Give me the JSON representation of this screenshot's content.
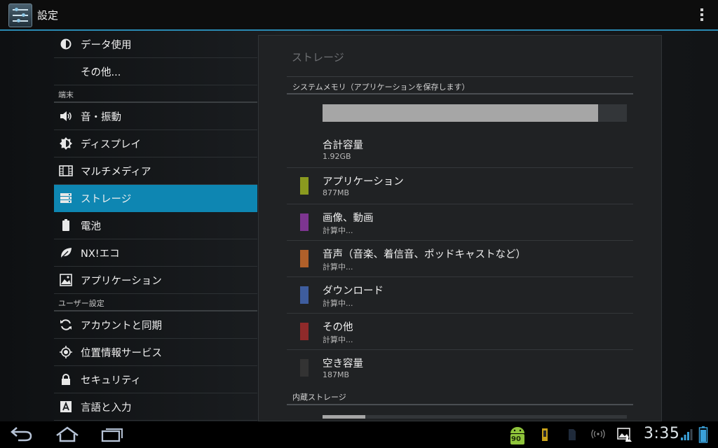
{
  "app": {
    "title": "設定",
    "icon": "settings-sliders-icon"
  },
  "sidebar": {
    "items": [
      {
        "label": "データ使用",
        "icon": "data-usage-icon"
      },
      {
        "label": "その他...",
        "icon": ""
      },
      {
        "section": "端末"
      },
      {
        "label": "音・振動",
        "icon": "volume-icon"
      },
      {
        "label": "ディスプレイ",
        "icon": "brightness-icon"
      },
      {
        "label": "マルチメディア",
        "icon": "film-icon"
      },
      {
        "label": "ストレージ",
        "icon": "storage-icon",
        "selected": true
      },
      {
        "label": "電池",
        "icon": "battery-icon"
      },
      {
        "label": "NX!エコ",
        "icon": "leaf-icon"
      },
      {
        "label": "アプリケーション",
        "icon": "apps-icon"
      },
      {
        "section": "ユーザー設定"
      },
      {
        "label": "アカウントと同期",
        "icon": "sync-icon"
      },
      {
        "label": "位置情報サービス",
        "icon": "location-icon"
      },
      {
        "label": "セキュリティ",
        "icon": "lock-icon"
      },
      {
        "label": "言語と入力",
        "icon": "keyboard-a-icon"
      }
    ]
  },
  "storage": {
    "title": "ストレージ",
    "system_section": "システムメモリ（アプリケーションを保存します）",
    "usage_fraction": 0.905,
    "rows": [
      {
        "title": "合計容量",
        "sub": "1.92GB",
        "color": ""
      },
      {
        "title": "アプリケーション",
        "sub": "877MB",
        "color": "#8a9a1f"
      },
      {
        "title": "画像、動画",
        "sub": "計算中...",
        "color": "#7d3590"
      },
      {
        "title": "音声（音楽、着信音、ポッドキャストなど）",
        "sub": "計算中...",
        "color": "#b0602a"
      },
      {
        "title": "ダウンロード",
        "sub": "計算中...",
        "color": "#3e5d9e"
      },
      {
        "title": "その他",
        "sub": "計算中...",
        "color": "#8f2a2a"
      },
      {
        "title": "空き容量",
        "sub": "187MB",
        "color": "#333333"
      }
    ],
    "internal_section": "内蔵ストレージ",
    "internal_usage_fraction": 0.14
  },
  "statusbar": {
    "time": "3:35",
    "notification_badge": "90",
    "icons": [
      "back-icon",
      "home-icon",
      "recent-apps-icon",
      "android-notification-icon",
      "sd-card-icon",
      "sim-icon",
      "wifi-hotspot-icon",
      "image-alert-icon",
      "signal-icon",
      "battery-status-icon"
    ]
  },
  "colors": {
    "accent": "#0e86b2",
    "panel": "#202224"
  }
}
